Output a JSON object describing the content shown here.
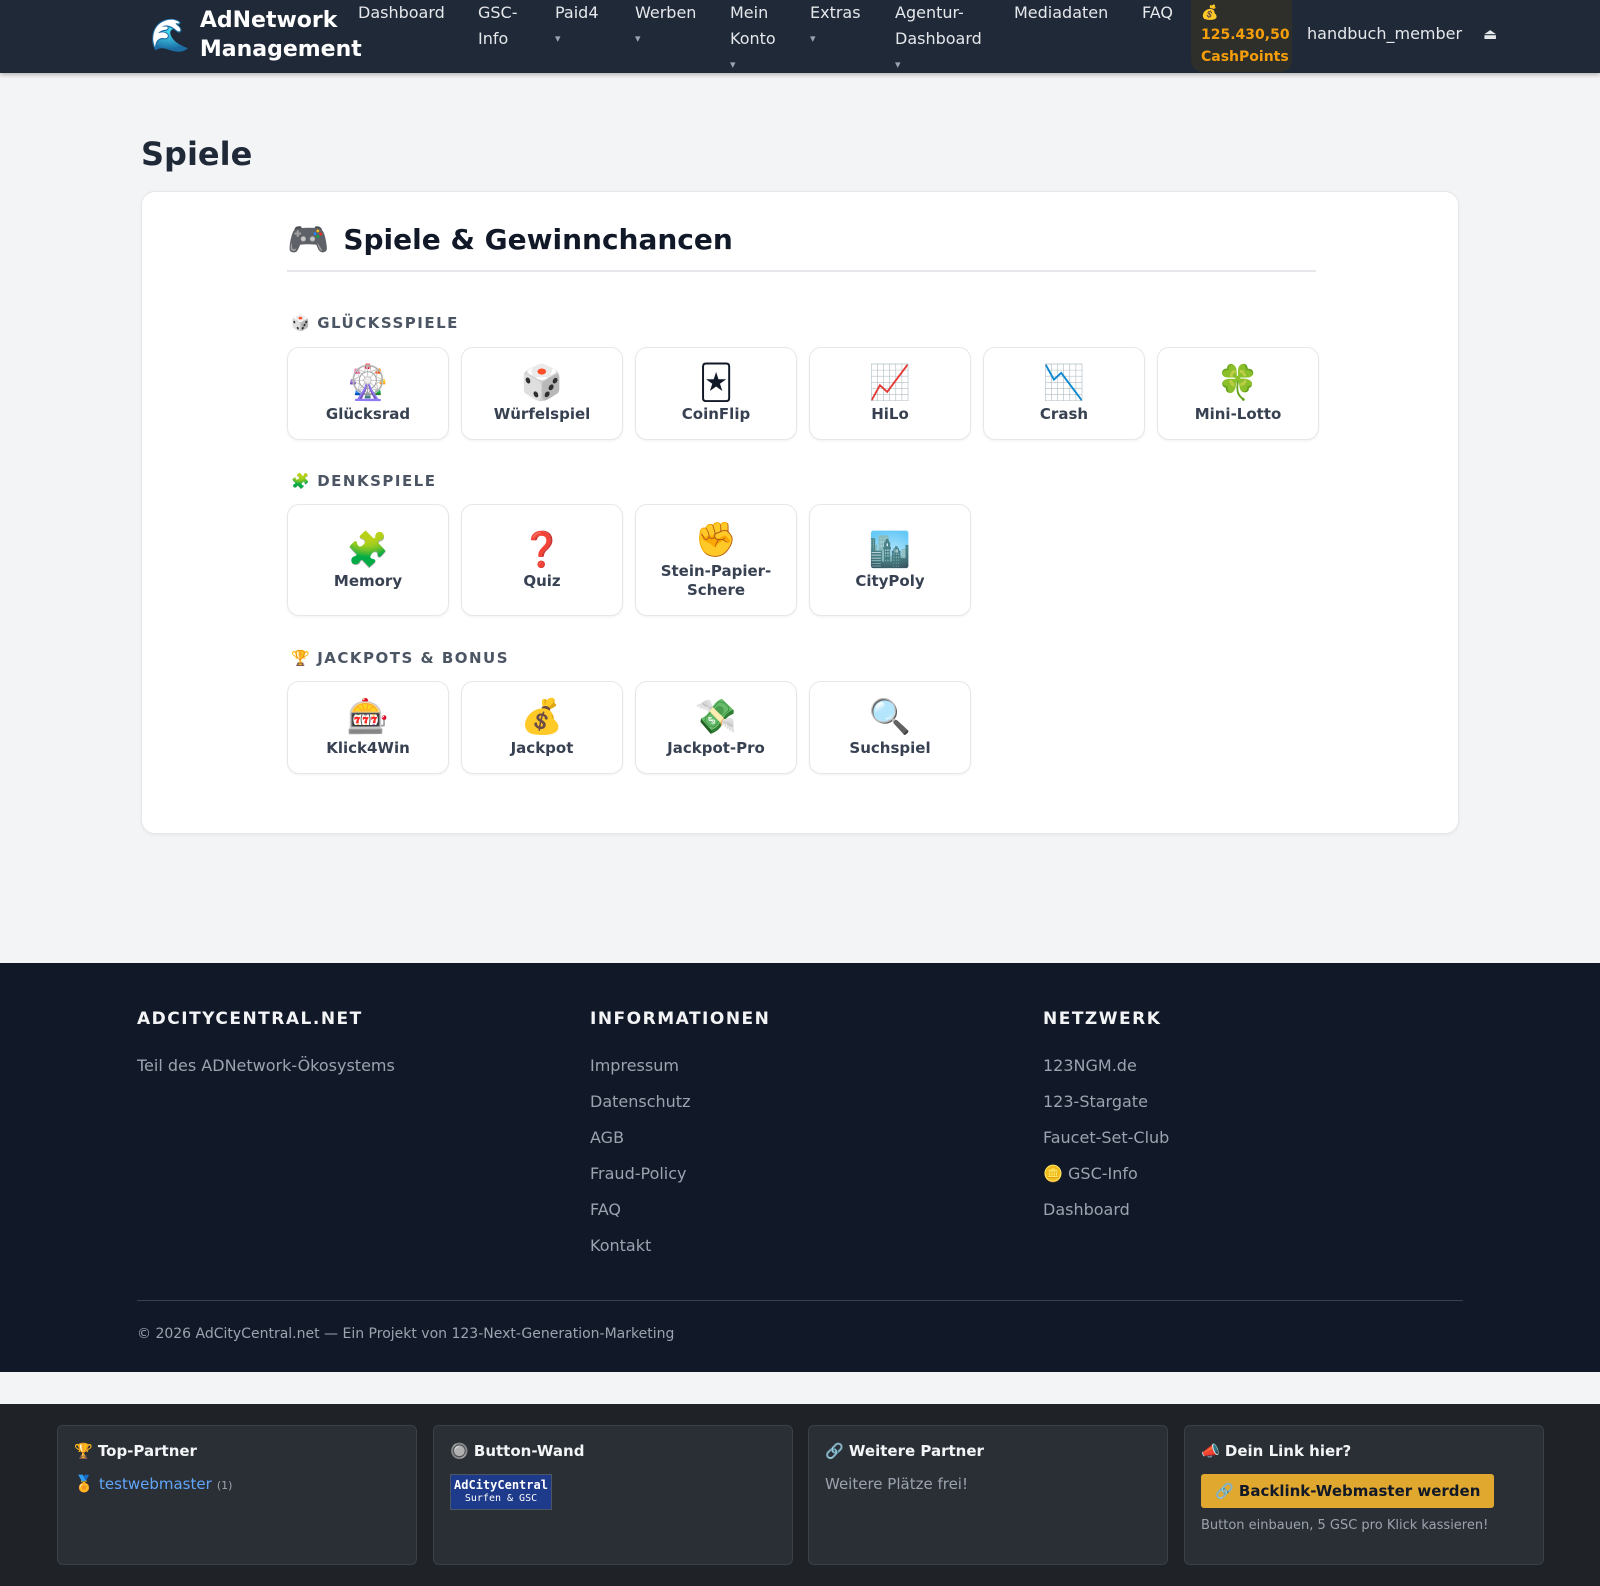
{
  "navbar": {
    "brand_icon": "🌊",
    "brand_line1": "AdNetwork",
    "brand_line2": "Management",
    "items": [
      {
        "line1": "Dashboard",
        "line2": "",
        "caret": ""
      },
      {
        "line1": "GSC-",
        "line2": "Info",
        "caret": ""
      },
      {
        "line1": "Paid4",
        "line2": "",
        "caret": "▾"
      },
      {
        "line1": "Werben",
        "line2": "",
        "caret": "▾"
      },
      {
        "line1": "Mein",
        "line2": "Konto",
        "caret": "▾"
      },
      {
        "line1": "Extras",
        "line2": "",
        "caret": "▾"
      },
      {
        "line1": "Agentur-",
        "line2": "Dashboard",
        "caret": "▾"
      },
      {
        "line1": "Mediadaten",
        "line2": "",
        "caret": ""
      },
      {
        "line1": "FAQ",
        "line2": "",
        "caret": ""
      }
    ],
    "cash_icon": "💰",
    "cash_amount": "125.430,50",
    "cash_unit": "CashPoints",
    "username": "handbuch_member",
    "logout_icon": "⏏"
  },
  "page": {
    "title": "Spiele",
    "card_icon": "🎮",
    "card_title": "Spiele & Gewinnchancen",
    "sections": [
      {
        "icon": "🎲",
        "label": "GLÜCKSSPIELE",
        "games": [
          {
            "icon": "🎡",
            "label": "Glücksrad"
          },
          {
            "icon": "🎲",
            "label": "Würfelspiel"
          },
          {
            "icon": "🃏",
            "label": "CoinFlip"
          },
          {
            "icon": "📈",
            "label": "HiLo"
          },
          {
            "icon": "📉",
            "label": "Crash"
          },
          {
            "icon": "🍀",
            "label": "Mini-Lotto"
          }
        ]
      },
      {
        "icon": "🧩",
        "label": "DENKSPIELE",
        "games": [
          {
            "icon": "🧩",
            "label": "Memory"
          },
          {
            "icon": "❓",
            "label": "Quiz"
          },
          {
            "icon": "✊",
            "label": "Stein-Papier-Schere"
          },
          {
            "icon": "🏙️",
            "label": "CityPoly"
          }
        ]
      },
      {
        "icon": "🏆",
        "label": "JACKPOTS & BONUS",
        "games": [
          {
            "icon": "🎰",
            "label": "Klick4Win"
          },
          {
            "icon": "💰",
            "label": "Jackpot"
          },
          {
            "icon": "💸",
            "label": "Jackpot-Pro"
          },
          {
            "icon": "🔍",
            "label": "Suchspiel"
          }
        ]
      }
    ]
  },
  "footer": {
    "col1": {
      "title": "ADCITYCENTRAL.NET",
      "text": "Teil des ADNetwork-Ökosystems"
    },
    "col2": {
      "title": "INFORMATIONEN",
      "links": [
        "Impressum",
        "Datenschutz",
        "AGB",
        "Fraud-Policy",
        "FAQ",
        "Kontakt"
      ]
    },
    "col3": {
      "title": "NETZWERK",
      "links": [
        "123NGM.de",
        "123-Stargate",
        "Faucet-Set-Club",
        "🪙 GSC-Info",
        "Dashboard"
      ]
    },
    "copyright": "© 2026 AdCityCentral.net — Ein Projekt von 123-Next-Generation-Marketing"
  },
  "bottombar": {
    "top_partner": {
      "title": "🏆 Top-Partner",
      "medal": "🏅",
      "name": "testwebmaster",
      "count": "(1)"
    },
    "button_wall": {
      "title": "🔘 Button-Wand",
      "button_line1": "AdCityCentral",
      "button_line2": "Surfen & GSC"
    },
    "more_partners": {
      "title": "🔗 Weitere Partner",
      "text": "Weitere Plätze frei!"
    },
    "your_link": {
      "title": "📣 Dein Link hier?",
      "button": "🔗 Backlink-Webmaster werden",
      "note": "Button einbauen, 5 GSC pro Klick kassieren!"
    }
  }
}
